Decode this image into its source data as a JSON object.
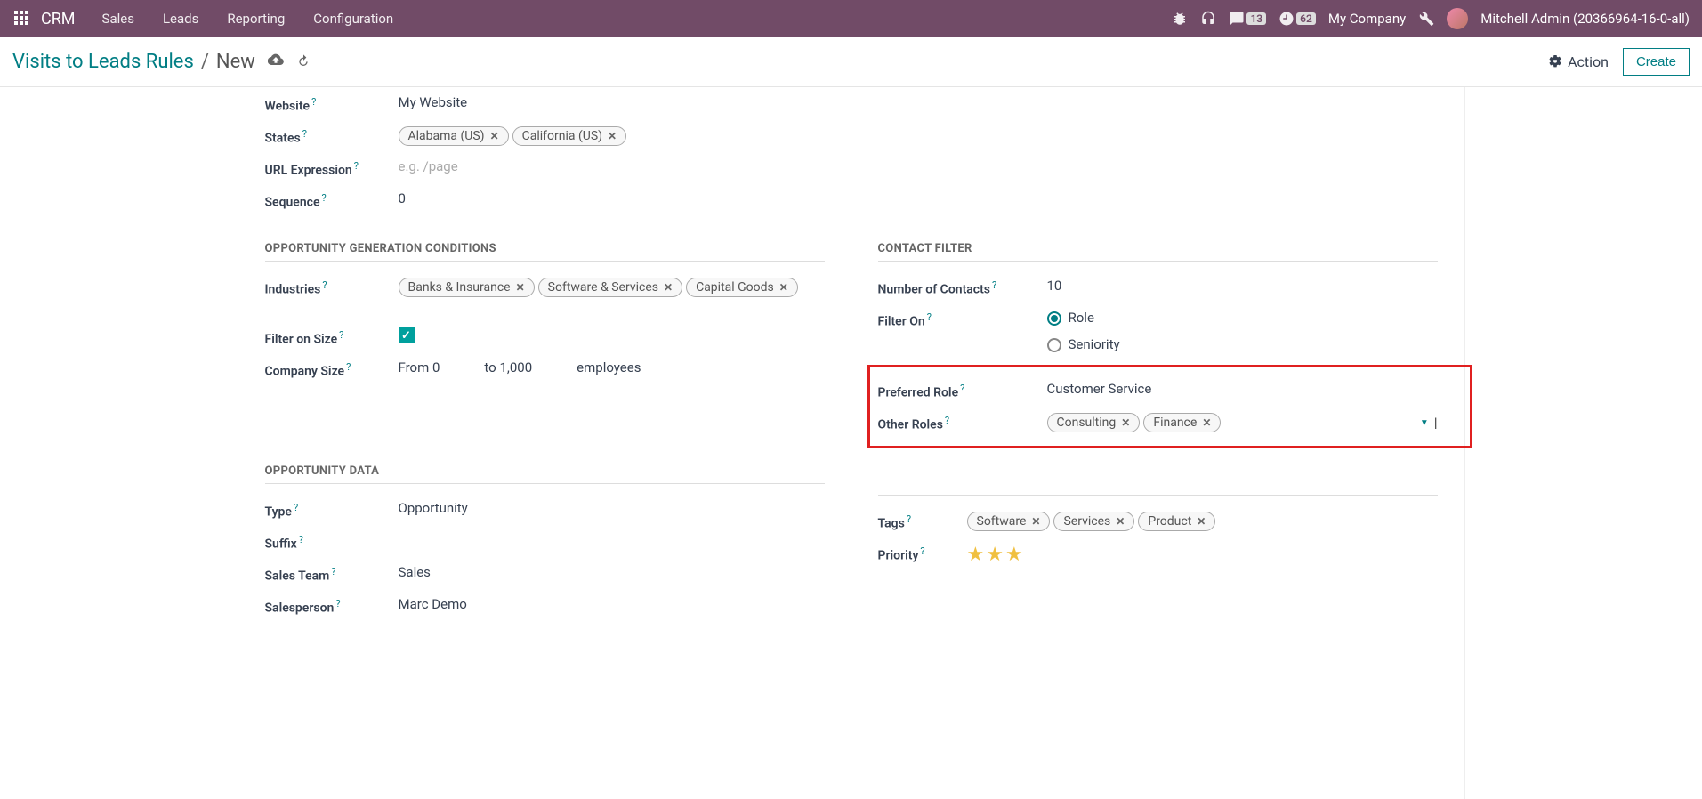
{
  "nav": {
    "brand": "CRM",
    "links": [
      "Sales",
      "Leads",
      "Reporting",
      "Configuration"
    ],
    "msg_count": "13",
    "clock_count": "62",
    "company": "My Company",
    "user": "Mitchell Admin (20366964-16-0-all)"
  },
  "breadcrumb": {
    "parent": "Visits to Leads Rules",
    "current": "New",
    "action_label": "Action",
    "create_label": "Create"
  },
  "left": {
    "website_label": "Website",
    "website_value": "My Website",
    "states_label": "States",
    "states": [
      "Alabama (US)",
      "California (US)"
    ],
    "url_label": "URL Expression",
    "url_placeholder": "e.g. /page",
    "sequence_label": "Sequence",
    "sequence_value": "0",
    "industries_label": "Industries",
    "industries": [
      "Banks & Insurance",
      "Software & Services",
      "Capital Goods"
    ],
    "filter_size_label": "Filter on Size",
    "company_size_label": "Company Size",
    "size_from_label": "From",
    "size_from_value": "0",
    "size_to_label": "to",
    "size_to_value": "1,000",
    "size_unit": "employees",
    "type_label": "Type",
    "type_value": "Opportunity",
    "suffix_label": "Suffix",
    "sales_team_label": "Sales Team",
    "sales_team_value": "Sales",
    "salesperson_label": "Salesperson",
    "salesperson_value": "Marc Demo"
  },
  "sections": {
    "opp_gen": "OPPORTUNITY GENERATION CONDITIONS",
    "contact_filter": "CONTACT FILTER",
    "opp_data": "OPPORTUNITY DATA"
  },
  "right": {
    "num_contacts_label": "Number of Contacts",
    "num_contacts_value": "10",
    "filter_on_label": "Filter On",
    "filter_role": "Role",
    "filter_seniority": "Seniority",
    "pref_role_label": "Preferred Role",
    "pref_role_value": "Customer Service",
    "other_roles_label": "Other Roles",
    "other_roles": [
      "Consulting",
      "Finance"
    ],
    "tags_label": "Tags",
    "tags": [
      "Software",
      "Services",
      "Product"
    ],
    "priority_label": "Priority"
  }
}
